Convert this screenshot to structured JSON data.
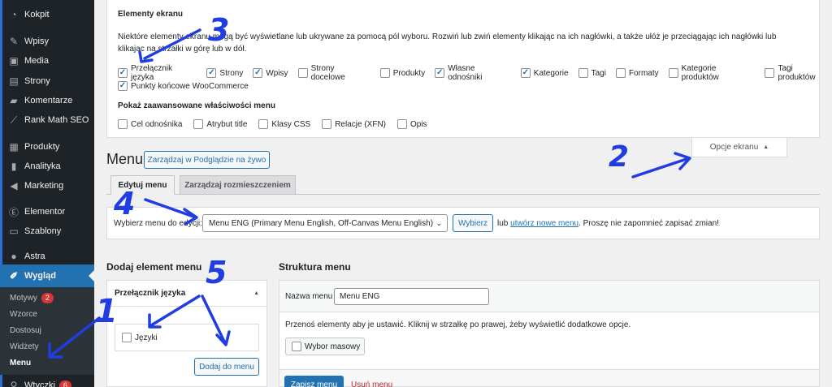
{
  "sidebar": {
    "items": [
      {
        "label": "Kokpit",
        "icon": "dashboard-icon"
      },
      {
        "label": "Wpisy",
        "icon": "pin-icon"
      },
      {
        "label": "Media",
        "icon": "media-icon"
      },
      {
        "label": "Strony",
        "icon": "page-icon"
      },
      {
        "label": "Komentarze",
        "icon": "comment-icon"
      },
      {
        "label": "Rank Math SEO",
        "icon": "chart-icon"
      },
      {
        "label": "Produkty",
        "icon": "archive-icon"
      },
      {
        "label": "Analityka",
        "icon": "bar-chart-icon"
      },
      {
        "label": "Marketing",
        "icon": "megaphone-icon"
      },
      {
        "label": "Elementor",
        "icon": "elementor-icon"
      },
      {
        "label": "Szablony",
        "icon": "folder-icon"
      },
      {
        "label": "Astra",
        "icon": "astra-icon"
      },
      {
        "label": "Wygląd",
        "icon": "brush-icon"
      },
      {
        "label": "Wtyczki",
        "icon": "plugin-icon",
        "badge": "6"
      }
    ],
    "submenu": [
      {
        "label": "Motywy",
        "badge": "2"
      },
      {
        "label": "Wzorce"
      },
      {
        "label": "Dostosuj"
      },
      {
        "label": "Widżety"
      },
      {
        "label": "Menu"
      }
    ]
  },
  "screen_options": {
    "title": "Elementy ekranu",
    "description": "Niektóre elementy ekranu mogą być wyświetlane lub ukrywane za pomocą pól wyboru. Rozwiń lub zwiń elementy klikając na ich nagłówki, a także ułóż je przeciągając ich nagłówki lub klikając na strzałki w górę lub w dół.",
    "boxes": [
      {
        "label": "Przełącznik języka",
        "checked": true
      },
      {
        "label": "Strony",
        "checked": true
      },
      {
        "label": "Wpisy",
        "checked": true
      },
      {
        "label": "Strony docelowe",
        "checked": false
      },
      {
        "label": "Produkty",
        "checked": false
      },
      {
        "label": "Własne odnośniki",
        "checked": true
      },
      {
        "label": "Kategorie",
        "checked": true
      },
      {
        "label": "Tagi",
        "checked": false
      },
      {
        "label": "Formaty",
        "checked": false
      },
      {
        "label": "Kategorie produktów",
        "checked": false
      },
      {
        "label": "Tagi produktów",
        "checked": false
      },
      {
        "label": "Punkty końcowe WooCommerce",
        "checked": true
      }
    ],
    "advanced_title": "Pokaż zaawansowane właściwości menu",
    "advanced": [
      {
        "label": "Cel odnośnika",
        "checked": false
      },
      {
        "label": "Atrybut title",
        "checked": false
      },
      {
        "label": "Klasy CSS",
        "checked": false
      },
      {
        "label": "Relacje (XFN)",
        "checked": false
      },
      {
        "label": "Opis",
        "checked": false
      }
    ],
    "toggle_label": "Opcje ekranu"
  },
  "page": {
    "title": "Menu",
    "live_preview_button": "Zarządzaj w Podglądzie na żywo",
    "tabs": [
      "Edytuj menu",
      "Zarządzaj rozmieszczeniem"
    ],
    "select_label": "Wybierz menu do edycji:",
    "select_value": "Menu ENG (Primary Menu English, Off-Canvas Menu English)",
    "select_button": "Wybierz",
    "or_text": "lub",
    "new_menu_link": "utwórz nowe menu",
    "save_reminder": ". Proszę nie zapomnieć zapisać zmian!"
  },
  "add_items": {
    "title": "Dodaj element menu",
    "box_title": "Przełącznik języka",
    "item_label": "Języki",
    "add_button": "Dodaj do menu"
  },
  "structure": {
    "title": "Struktura menu",
    "name_label": "Nazwa menu",
    "name_value": "Menu ENG",
    "hint": "Przenoś elementy aby je ustawić. Kliknij w strzałkę po prawej, żeby wyświetlić dodatkowe opcje.",
    "bulk_label": "Wybor masowy",
    "save_button": "Zapisz menu",
    "delete_link": "Usuń menu"
  },
  "annotations": [
    "1",
    "2",
    "3",
    "4",
    "5"
  ],
  "colors": {
    "accent": "#2271b1",
    "sidebar": "#1d2327",
    "annotation": "#1f3de0",
    "badge": "#d63638"
  }
}
